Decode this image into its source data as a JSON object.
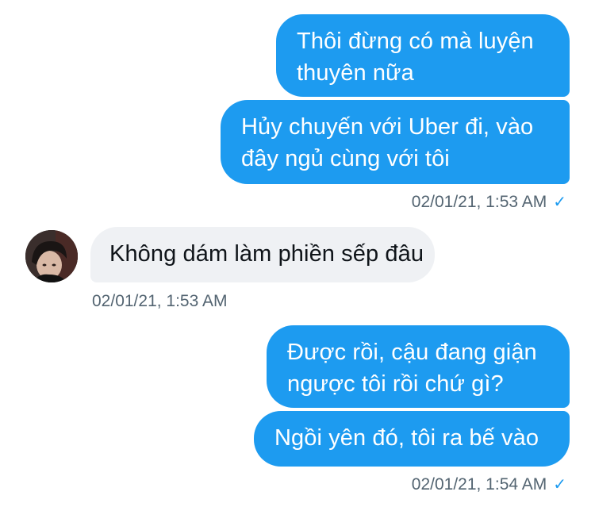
{
  "conversation": {
    "out_group_1": {
      "messages": [
        [
          "Thôi đừng có mà luyện",
          "thuyên nữa"
        ],
        [
          "Hủy chuyến với Uber đi, vào",
          "đây ngủ cùng với tôi"
        ]
      ],
      "timestamp": "02/01/21, 1:53 AM",
      "status_icon": "check-icon"
    },
    "in_group_1": {
      "avatar_icon": "avatar",
      "messages": [
        "Không dám làm phiền sếp đâu"
      ],
      "timestamp": "02/01/21, 1:53 AM"
    },
    "out_group_2": {
      "messages": [
        [
          "Được rồi, cậu đang giận",
          "ngược tôi rồi chứ gì?"
        ],
        [
          "Ngồi yên đó, tôi ra bế vào"
        ]
      ],
      "timestamp": "02/01/21, 1:54 AM",
      "status_icon": "check-icon"
    },
    "colors": {
      "outgoing_bubble": "#1d9bf0",
      "incoming_bubble": "#eff1f4",
      "timestamp_text": "#536471"
    }
  }
}
